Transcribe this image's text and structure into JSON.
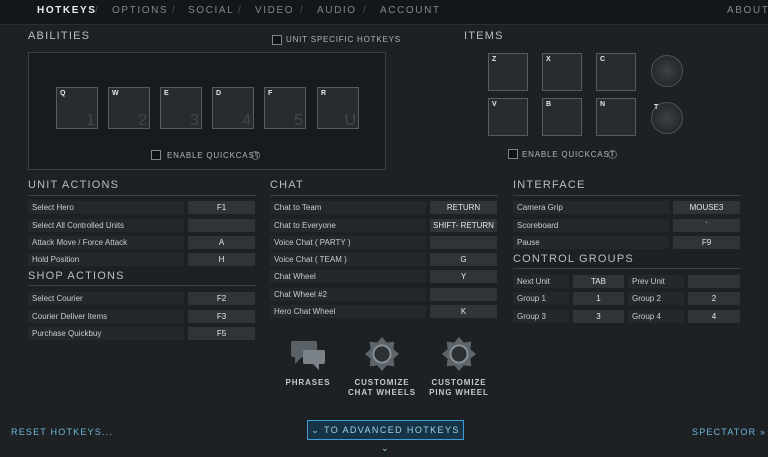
{
  "nav": {
    "tabs": [
      "HOTKEYS",
      "OPTIONS",
      "SOCIAL",
      "VIDEO",
      "AUDIO",
      "ACCOUNT"
    ],
    "about": "ABOUT"
  },
  "abilities": {
    "title": "ABILITIES",
    "unit_specific": "UNIT SPECIFIC HOTKEYS",
    "slots": [
      {
        "key": "Q",
        "num": "1"
      },
      {
        "key": "W",
        "num": "2"
      },
      {
        "key": "E",
        "num": "3"
      },
      {
        "key": "D",
        "num": "4"
      },
      {
        "key": "F",
        "num": "5"
      },
      {
        "key": "R",
        "num": "U"
      }
    ],
    "quickcast": "ENABLE QUICKCAST"
  },
  "items": {
    "title": "ITEMS",
    "slots": [
      "Z",
      "X",
      "C",
      "V",
      "B",
      "N"
    ],
    "round_slots": [
      "",
      "T"
    ],
    "quickcast": "ENABLE QUICKCAST"
  },
  "unit_actions": {
    "title": "UNIT ACTIONS",
    "rows": [
      {
        "label": "Select Hero",
        "key": "F1"
      },
      {
        "label": "Select All Controlled Units",
        "key": ""
      },
      {
        "label": "Attack Move / Force Attack",
        "key": "A"
      },
      {
        "label": "Hold Position",
        "key": "H"
      }
    ]
  },
  "shop_actions": {
    "title": "SHOP ACTIONS",
    "rows": [
      {
        "label": "Select Courier",
        "key": "F2"
      },
      {
        "label": "Courier Deliver Items",
        "key": "F3"
      },
      {
        "label": "Purchase Quickbuy",
        "key": "F5"
      }
    ]
  },
  "chat": {
    "title": "CHAT",
    "rows": [
      {
        "label": "Chat to Team",
        "key": "RETURN"
      },
      {
        "label": "Chat to Everyone",
        "key": "SHIFT- RETURN"
      },
      {
        "label": "Voice Chat ( PARTY )",
        "key": ""
      },
      {
        "label": "Voice Chat ( TEAM )",
        "key": "G"
      },
      {
        "label": "Chat Wheel",
        "key": "Y"
      },
      {
        "label": "Chat Wheel #2",
        "key": ""
      },
      {
        "label": "Hero Chat Wheel",
        "key": "K"
      }
    ]
  },
  "interface": {
    "title": "INTERFACE",
    "rows": [
      {
        "label": "Camera Grip",
        "key": "MOUSE3"
      },
      {
        "label": "Scoreboard",
        "key": "`"
      },
      {
        "label": "Pause",
        "key": "F9"
      }
    ]
  },
  "control_groups": {
    "title": "CONTROL GROUPS",
    "rows": [
      {
        "l1": "Next Unit",
        "k1": "TAB",
        "l2": "Prev Unit",
        "k2": ""
      },
      {
        "l1": "Group 1",
        "k1": "1",
        "l2": "Group 2",
        "k2": "2"
      },
      {
        "l1": "Group 3",
        "k1": "3",
        "l2": "Group 4",
        "k2": "4"
      }
    ]
  },
  "bottom": {
    "phrases": "PHRASES",
    "chat_wheels": [
      "CUSTOMIZE",
      "CHAT WHEELS"
    ],
    "ping_wheel": [
      "CUSTOMIZE",
      "PING WHEEL"
    ],
    "advanced": "TO ADVANCED HOTKEYS",
    "reset": "RESET HOTKEYS...",
    "spectator": "SPECTATOR"
  }
}
